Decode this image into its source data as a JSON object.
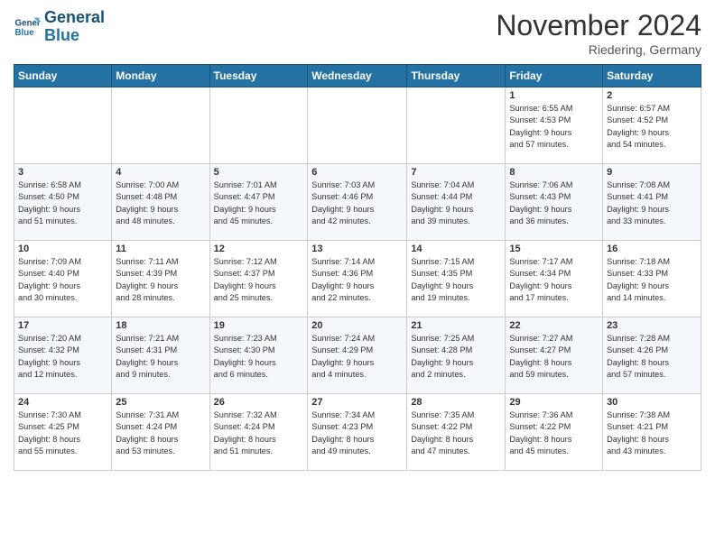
{
  "header": {
    "logo_line1": "General",
    "logo_line2": "Blue",
    "month_title": "November 2024",
    "location": "Riedering, Germany"
  },
  "weekdays": [
    "Sunday",
    "Monday",
    "Tuesday",
    "Wednesday",
    "Thursday",
    "Friday",
    "Saturday"
  ],
  "weeks": [
    [
      {
        "day": "",
        "detail": ""
      },
      {
        "day": "",
        "detail": ""
      },
      {
        "day": "",
        "detail": ""
      },
      {
        "day": "",
        "detail": ""
      },
      {
        "day": "",
        "detail": ""
      },
      {
        "day": "1",
        "detail": "Sunrise: 6:55 AM\nSunset: 4:53 PM\nDaylight: 9 hours\nand 57 minutes."
      },
      {
        "day": "2",
        "detail": "Sunrise: 6:57 AM\nSunset: 4:52 PM\nDaylight: 9 hours\nand 54 minutes."
      }
    ],
    [
      {
        "day": "3",
        "detail": "Sunrise: 6:58 AM\nSunset: 4:50 PM\nDaylight: 9 hours\nand 51 minutes."
      },
      {
        "day": "4",
        "detail": "Sunrise: 7:00 AM\nSunset: 4:48 PM\nDaylight: 9 hours\nand 48 minutes."
      },
      {
        "day": "5",
        "detail": "Sunrise: 7:01 AM\nSunset: 4:47 PM\nDaylight: 9 hours\nand 45 minutes."
      },
      {
        "day": "6",
        "detail": "Sunrise: 7:03 AM\nSunset: 4:46 PM\nDaylight: 9 hours\nand 42 minutes."
      },
      {
        "day": "7",
        "detail": "Sunrise: 7:04 AM\nSunset: 4:44 PM\nDaylight: 9 hours\nand 39 minutes."
      },
      {
        "day": "8",
        "detail": "Sunrise: 7:06 AM\nSunset: 4:43 PM\nDaylight: 9 hours\nand 36 minutes."
      },
      {
        "day": "9",
        "detail": "Sunrise: 7:08 AM\nSunset: 4:41 PM\nDaylight: 9 hours\nand 33 minutes."
      }
    ],
    [
      {
        "day": "10",
        "detail": "Sunrise: 7:09 AM\nSunset: 4:40 PM\nDaylight: 9 hours\nand 30 minutes."
      },
      {
        "day": "11",
        "detail": "Sunrise: 7:11 AM\nSunset: 4:39 PM\nDaylight: 9 hours\nand 28 minutes."
      },
      {
        "day": "12",
        "detail": "Sunrise: 7:12 AM\nSunset: 4:37 PM\nDaylight: 9 hours\nand 25 minutes."
      },
      {
        "day": "13",
        "detail": "Sunrise: 7:14 AM\nSunset: 4:36 PM\nDaylight: 9 hours\nand 22 minutes."
      },
      {
        "day": "14",
        "detail": "Sunrise: 7:15 AM\nSunset: 4:35 PM\nDaylight: 9 hours\nand 19 minutes."
      },
      {
        "day": "15",
        "detail": "Sunrise: 7:17 AM\nSunset: 4:34 PM\nDaylight: 9 hours\nand 17 minutes."
      },
      {
        "day": "16",
        "detail": "Sunrise: 7:18 AM\nSunset: 4:33 PM\nDaylight: 9 hours\nand 14 minutes."
      }
    ],
    [
      {
        "day": "17",
        "detail": "Sunrise: 7:20 AM\nSunset: 4:32 PM\nDaylight: 9 hours\nand 12 minutes."
      },
      {
        "day": "18",
        "detail": "Sunrise: 7:21 AM\nSunset: 4:31 PM\nDaylight: 9 hours\nand 9 minutes."
      },
      {
        "day": "19",
        "detail": "Sunrise: 7:23 AM\nSunset: 4:30 PM\nDaylight: 9 hours\nand 6 minutes."
      },
      {
        "day": "20",
        "detail": "Sunrise: 7:24 AM\nSunset: 4:29 PM\nDaylight: 9 hours\nand 4 minutes."
      },
      {
        "day": "21",
        "detail": "Sunrise: 7:25 AM\nSunset: 4:28 PM\nDaylight: 9 hours\nand 2 minutes."
      },
      {
        "day": "22",
        "detail": "Sunrise: 7:27 AM\nSunset: 4:27 PM\nDaylight: 8 hours\nand 59 minutes."
      },
      {
        "day": "23",
        "detail": "Sunrise: 7:28 AM\nSunset: 4:26 PM\nDaylight: 8 hours\nand 57 minutes."
      }
    ],
    [
      {
        "day": "24",
        "detail": "Sunrise: 7:30 AM\nSunset: 4:25 PM\nDaylight: 8 hours\nand 55 minutes."
      },
      {
        "day": "25",
        "detail": "Sunrise: 7:31 AM\nSunset: 4:24 PM\nDaylight: 8 hours\nand 53 minutes."
      },
      {
        "day": "26",
        "detail": "Sunrise: 7:32 AM\nSunset: 4:24 PM\nDaylight: 8 hours\nand 51 minutes."
      },
      {
        "day": "27",
        "detail": "Sunrise: 7:34 AM\nSunset: 4:23 PM\nDaylight: 8 hours\nand 49 minutes."
      },
      {
        "day": "28",
        "detail": "Sunrise: 7:35 AM\nSunset: 4:22 PM\nDaylight: 8 hours\nand 47 minutes."
      },
      {
        "day": "29",
        "detail": "Sunrise: 7:36 AM\nSunset: 4:22 PM\nDaylight: 8 hours\nand 45 minutes."
      },
      {
        "day": "30",
        "detail": "Sunrise: 7:38 AM\nSunset: 4:21 PM\nDaylight: 8 hours\nand 43 minutes."
      }
    ]
  ]
}
